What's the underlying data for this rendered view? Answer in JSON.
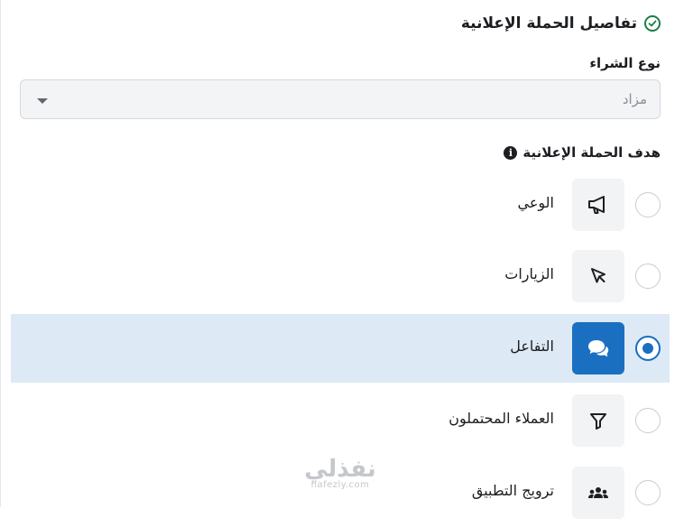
{
  "section": {
    "title": "تفاصيل الحملة الإعلانية",
    "status_icon": "check-circle-icon",
    "status_color": "#1d7d49"
  },
  "purchase_type": {
    "label": "نوع الشراء",
    "value": "مزاد"
  },
  "objective": {
    "label": "هدف الحملة الإعلانية",
    "info_glyph": "i"
  },
  "options": [
    {
      "label": "الوعي",
      "icon": "megaphone-icon",
      "selected": false
    },
    {
      "label": "الزيارات",
      "icon": "cursor-icon",
      "selected": false
    },
    {
      "label": "التفاعل",
      "icon": "chat-bubbles-icon",
      "selected": true
    },
    {
      "label": "العملاء المحتملون",
      "icon": "funnel-icon",
      "selected": false
    },
    {
      "label": "ترويج التطبيق",
      "icon": "users-icon",
      "selected": false
    }
  ],
  "watermark": {
    "arabic": "نفذلي",
    "latin": "nafezly.com"
  },
  "colors": {
    "accent": "#1a6fc1",
    "selected_row": "#dde9f5",
    "success": "#1d7d49"
  }
}
